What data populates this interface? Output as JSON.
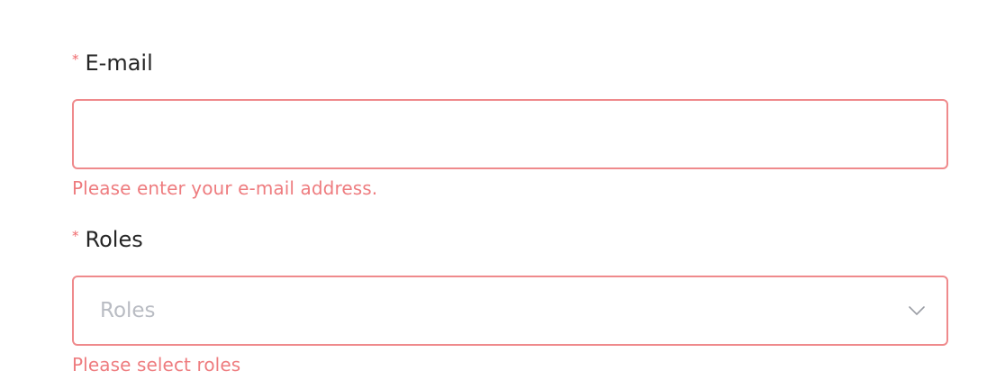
{
  "email_field": {
    "required_mark": "*",
    "label": "E-mail",
    "value": "",
    "placeholder": "",
    "error": "Please enter your e-mail address."
  },
  "roles_field": {
    "required_mark": "*",
    "label": "Roles",
    "placeholder": "Roles",
    "error": "Please select roles"
  },
  "icons": {
    "roles_dropdown": "chevron-down-icon"
  },
  "colors": {
    "error": "#ee7c7f",
    "error_border": "#ef8a8c",
    "label": "#262626",
    "placeholder": "#b9bcc3"
  }
}
